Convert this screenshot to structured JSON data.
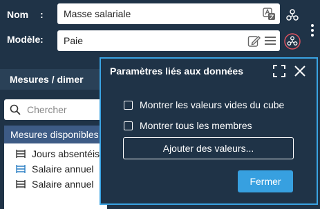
{
  "form": {
    "name_label": "Nom",
    "name_colon": ":",
    "name_value": "Masse salariale",
    "model_label": "Modèle",
    "model_colon": ":",
    "model_value": "Paie"
  },
  "left_panel": {
    "title": "Mesures / dimer",
    "search_placeholder": "Chercher",
    "selected_item": "Mesures disponibles",
    "items": [
      {
        "label": "Jours absentéis",
        "icon": "measure-icon",
        "highlight": false
      },
      {
        "label": "Salaire annuel",
        "icon": "measure-icon",
        "highlight": true
      },
      {
        "label": "Salaire annuel",
        "icon": "measure-icon",
        "highlight": false
      }
    ]
  },
  "dialog": {
    "title": "Paramètres liés aux données",
    "checkbox_empty_values": "Montrer les valeurs vides du cube",
    "checkbox_all_members": "Montrer tous les membres",
    "add_values_button": "Ajouter des valeurs...",
    "close_button": "Fermer"
  },
  "colors": {
    "background": "#1f3347",
    "accent": "#37a0e0",
    "selected": "#3d5b85",
    "alert_ring": "#e05260"
  }
}
